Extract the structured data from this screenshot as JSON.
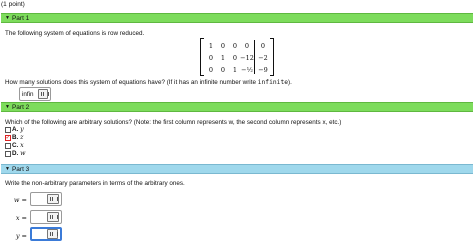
{
  "points": "(1 point)",
  "part1": {
    "label": "Part 1",
    "text": "The following system of equations is row reduced.",
    "matrix": [
      [
        "1",
        "0",
        "0",
        "0",
        "0"
      ],
      [
        "0",
        "1",
        "0",
        "−12",
        "−2"
      ],
      [
        "0",
        "0",
        "1",
        "−½",
        "−9"
      ]
    ],
    "question": "How many solutions does this system of equations have? (If it has an infinite number write ",
    "question_code": "infinite",
    "question_end": ").",
    "answer": "infin"
  },
  "part2": {
    "label": "Part 2",
    "text": "Which of the following are arbitrary solutions? (Note: the first column represents w, the second column represents x, etc.)",
    "options": [
      {
        "letter": "A.",
        "var": "y",
        "checked": false
      },
      {
        "letter": "B.",
        "var": "z",
        "checked": true
      },
      {
        "letter": "C.",
        "var": "x",
        "checked": false
      },
      {
        "letter": "D.",
        "var": "w",
        "checked": false
      }
    ]
  },
  "part3": {
    "label": "Part 3",
    "text": "Write the non-arbitrary parameters in terms of the arbitrary ones.",
    "rows": [
      {
        "var": "w =",
        "value": ""
      },
      {
        "var": "x =",
        "value": ""
      },
      {
        "var": "y =",
        "value": ""
      }
    ]
  },
  "colors": {
    "part_green": "#7ddc5c",
    "part_blue": "#9fd8ec",
    "focus_blue": "#3b7bd8",
    "check_red": "#d22222"
  }
}
